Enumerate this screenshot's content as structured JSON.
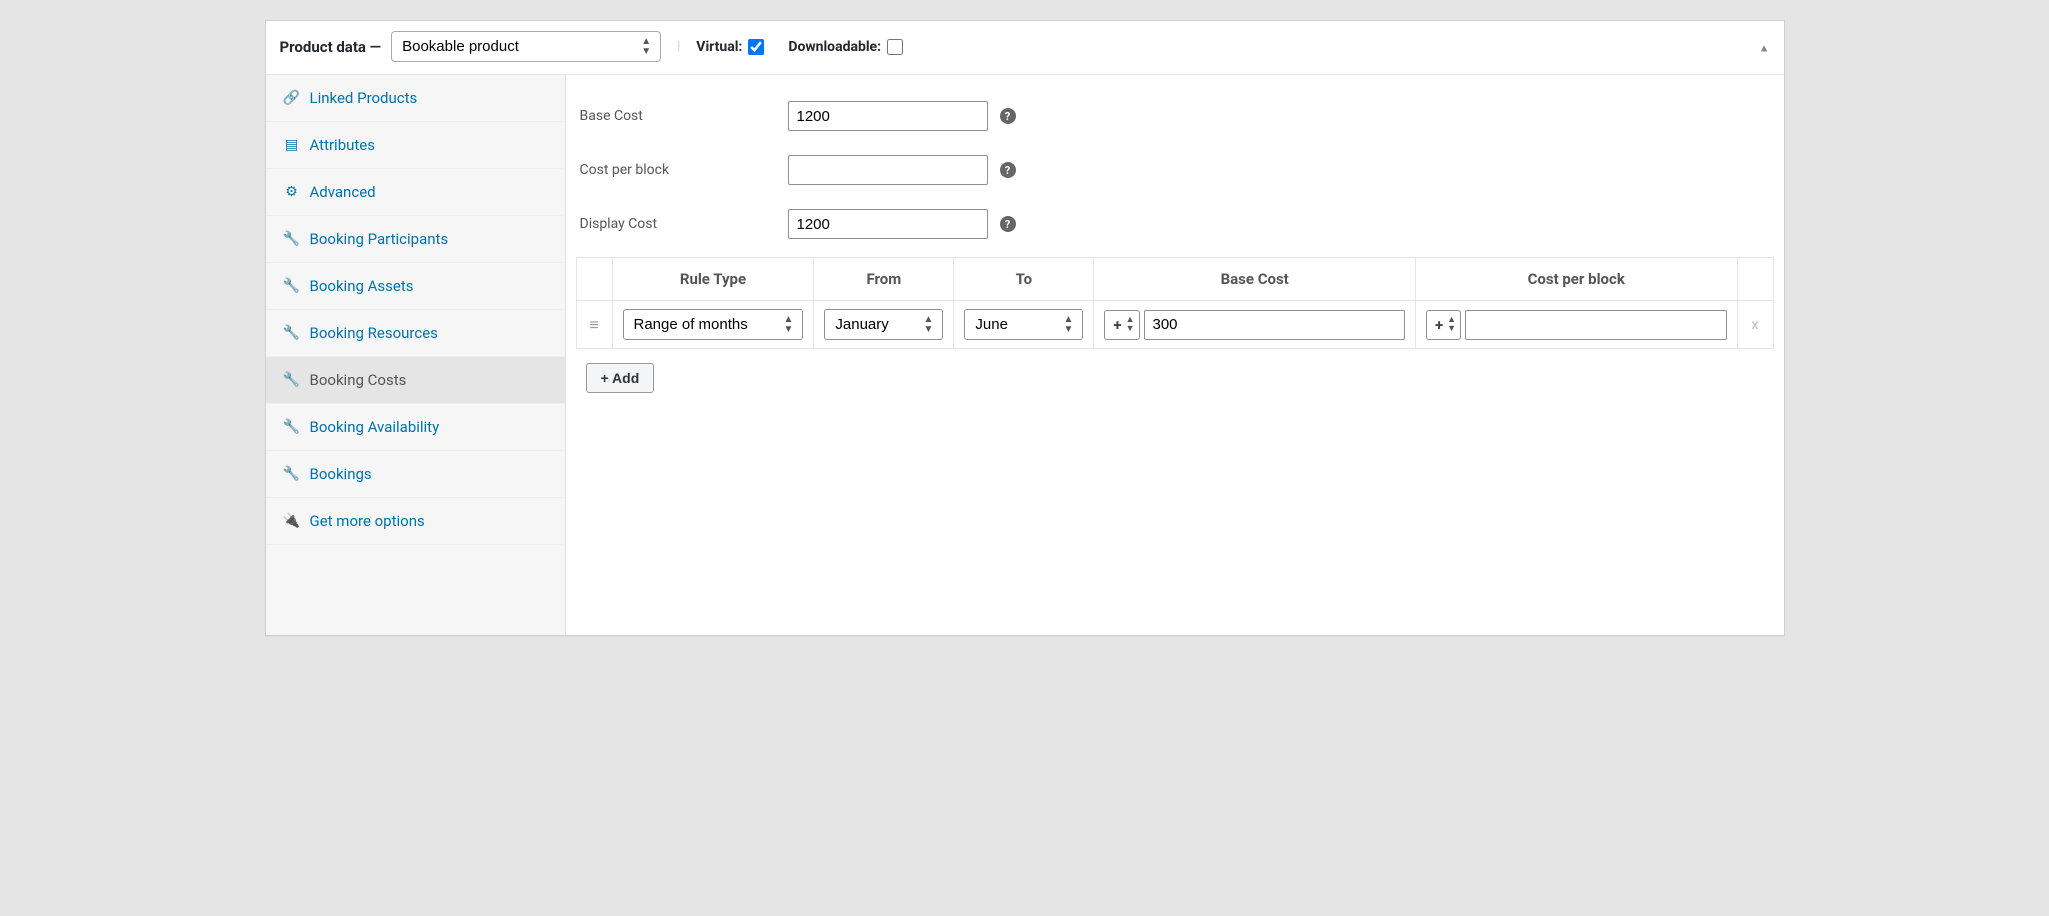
{
  "header": {
    "title": "Product data —",
    "product_type": "Bookable product",
    "virtual_label": "Virtual:",
    "virtual_checked": true,
    "downloadable_label": "Downloadable:",
    "downloadable_checked": false
  },
  "sidebar": {
    "items": [
      {
        "label": "Linked Products",
        "icon": "link-icon",
        "active": false
      },
      {
        "label": "Attributes",
        "icon": "list-icon",
        "active": false
      },
      {
        "label": "Advanced",
        "icon": "gear-icon",
        "active": false
      },
      {
        "label": "Booking Participants",
        "icon": "wrench-icon",
        "active": false
      },
      {
        "label": "Booking Assets",
        "icon": "wrench-icon",
        "active": false
      },
      {
        "label": "Booking Resources",
        "icon": "wrench-icon",
        "active": false
      },
      {
        "label": "Booking Costs",
        "icon": "wrench-icon",
        "active": true
      },
      {
        "label": "Booking Availability",
        "icon": "wrench-icon",
        "active": false
      },
      {
        "label": "Bookings",
        "icon": "wrench-icon",
        "active": false
      },
      {
        "label": "Get more options",
        "icon": "plugin-icon",
        "active": false
      }
    ]
  },
  "fields": {
    "base_cost_label": "Base Cost",
    "base_cost_value": "1200",
    "cost_per_block_label": "Cost per block",
    "cost_per_block_value": "",
    "display_cost_label": "Display Cost",
    "display_cost_value": "1200"
  },
  "table": {
    "headers": {
      "rule_type": "Rule Type",
      "from": "From",
      "to": "To",
      "base_cost": "Base Cost",
      "cost_per_block": "Cost per block"
    },
    "row": {
      "rule_type": "Range of months",
      "from": "January",
      "to": "June",
      "base_cost_op": "+",
      "base_cost_value": "300",
      "cost_per_block_op": "+",
      "cost_per_block_value": "",
      "remove": "x"
    },
    "add_button": "+ Add"
  }
}
